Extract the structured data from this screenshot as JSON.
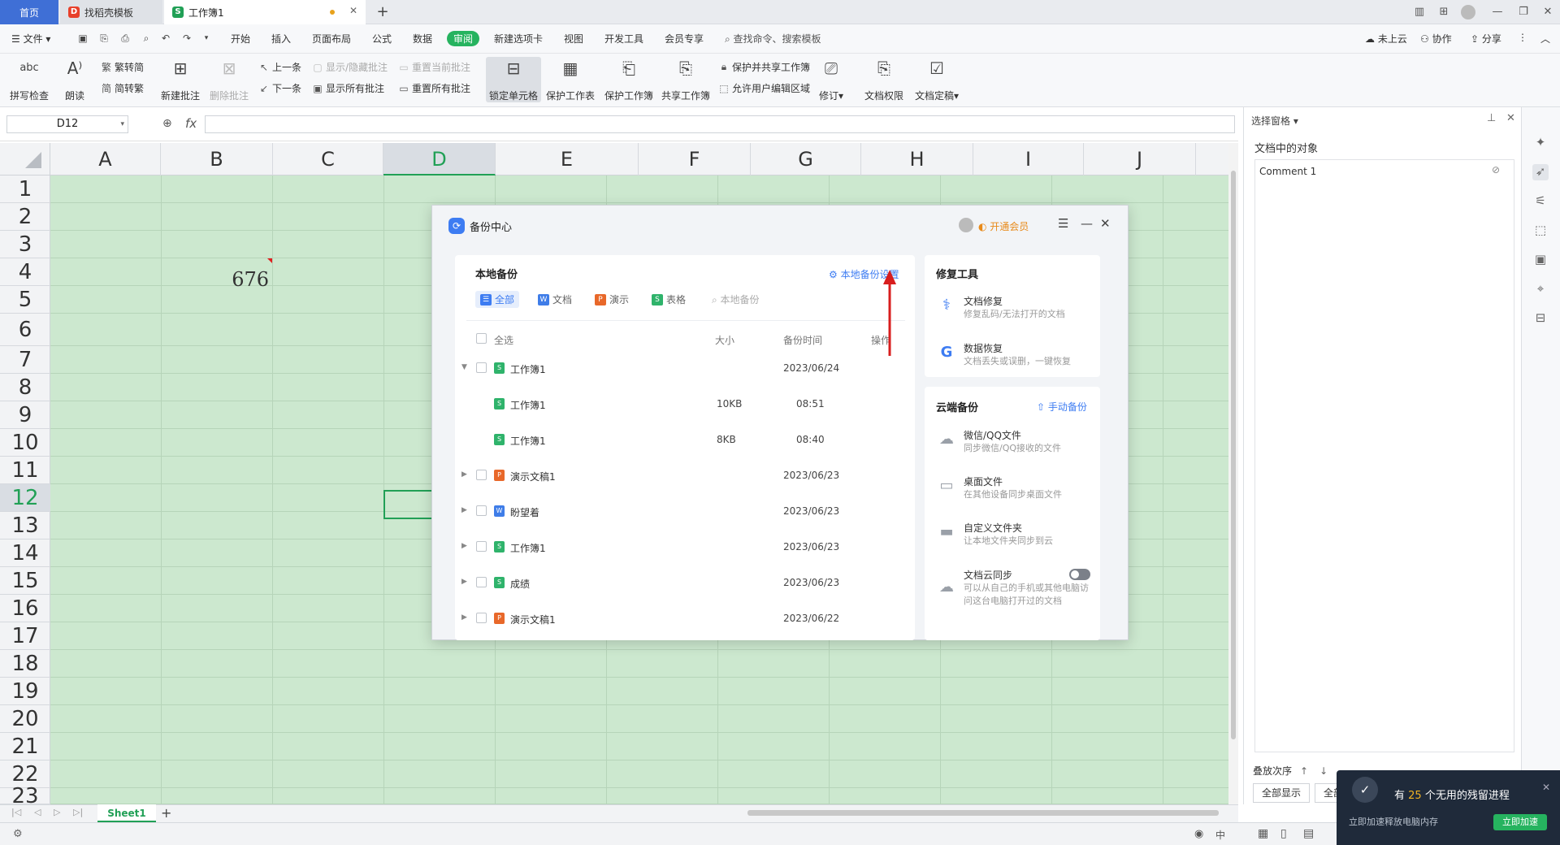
{
  "tabs": {
    "home": "首页",
    "template": "找稻壳模板",
    "workbook": "工作簿1",
    "new_tab": "+"
  },
  "menu": {
    "file": "文件",
    "items": [
      "开始",
      "插入",
      "页面布局",
      "公式",
      "数据",
      "审阅",
      "新建选项卡",
      "视图",
      "开发工具",
      "会员专享"
    ],
    "search": "查找命令、搜索模板",
    "cloud": "未上云",
    "collab": "协作",
    "share": "分享"
  },
  "ribbon": {
    "spell": "拼写检查",
    "read": "朗读",
    "trad": "繁转简",
    "simp": "简转繁",
    "new_comment": "新建批注",
    "del_comment": "删除批注",
    "prev": "上一条",
    "next": "下一条",
    "show_hide": "显示/隐藏批注",
    "show_all": "显示所有批注",
    "reset_cur": "重置当前批注",
    "reset_all": "重置所有批注",
    "lock_cell": "锁定单元格",
    "protect_sheet": "保护工作表",
    "protect_wb": "保护工作簿",
    "share_wb": "共享工作簿",
    "protect_share": "保护并共享工作簿",
    "allow_edit": "允许用户编辑区域",
    "revise": "修订",
    "doc_perm": "文档权限",
    "doc_final": "文档定稿"
  },
  "formula": {
    "namebox": "D12",
    "fx": "fx",
    "value": ""
  },
  "grid": {
    "columns": [
      "A",
      "B",
      "C",
      "D",
      "E",
      "F",
      "G",
      "H",
      "I",
      "J"
    ],
    "rows": [
      "1",
      "2",
      "3",
      "4",
      "5",
      "6",
      "7",
      "8",
      "9",
      "10",
      "11",
      "12",
      "13",
      "14",
      "15",
      "16",
      "17",
      "18",
      "19",
      "20",
      "21",
      "22",
      "23"
    ],
    "selected_col": "D",
    "selected_row": "12",
    "cell_b4": "676"
  },
  "sheets": {
    "active": "Sheet1",
    "add": "+"
  },
  "selection_pane": {
    "title": "选择窗格",
    "subtitle": "文档中的对象",
    "object": "Comment 1",
    "order": "叠放次序",
    "show_all": "全部显示",
    "hide_all": "全部隐藏"
  },
  "backup_dialog": {
    "title": "备份中心",
    "vip": "开通会员",
    "local": {
      "title": "本地备份",
      "settings": "本地备份设置",
      "filters": [
        "全部",
        "文档",
        "演示",
        "表格"
      ],
      "search": "本地备份",
      "headers": {
        "select_all": "全选",
        "size": "大小",
        "time": "备份时间",
        "op": "操作"
      },
      "rows": [
        {
          "name": "工作簿1",
          "size": "",
          "time": "2023/06/24",
          "type": "s",
          "level": 0
        },
        {
          "name": "工作簿1",
          "size": "10KB",
          "time": "08:51",
          "type": "s",
          "level": 1
        },
        {
          "name": "工作簿1",
          "size": "8KB",
          "time": "08:40",
          "type": "s",
          "level": 1
        },
        {
          "name": "演示文稿1",
          "size": "",
          "time": "2023/06/23",
          "type": "p",
          "level": 0
        },
        {
          "name": "盼望着",
          "size": "",
          "time": "2023/06/23",
          "type": "w",
          "level": 0
        },
        {
          "name": "工作簿1",
          "size": "",
          "time": "2023/06/23",
          "type": "s",
          "level": 0
        },
        {
          "name": "成绩",
          "size": "",
          "time": "2023/06/23",
          "type": "s",
          "level": 0
        },
        {
          "name": "演示文稿1",
          "size": "",
          "time": "2023/06/22",
          "type": "p",
          "level": 0
        }
      ]
    },
    "repair": {
      "title": "修复工具",
      "items": [
        {
          "t": "文档修复",
          "d": "修复乱码/无法打开的文档"
        },
        {
          "t": "数据恢复",
          "d": "文档丢失或误删，一键恢复"
        }
      ]
    },
    "cloud": {
      "title": "云端备份",
      "manual": "手动备份",
      "items": [
        {
          "t": "微信/QQ文件",
          "d": "同步微信/QQ接收的文件"
        },
        {
          "t": "桌面文件",
          "d": "在其他设备同步桌面文件"
        },
        {
          "t": "自定义文件夹",
          "d": "让本地文件夹同步到云"
        },
        {
          "t": "文档云同步",
          "d": "可以从自己的手机或其他电脑访问这台电脑打开过的文档"
        }
      ]
    }
  },
  "notification": {
    "pre": "有",
    "count": "25",
    "post": "个无用的残留进程",
    "sub": "立即加速释放电脑内存",
    "button": "立即加速"
  },
  "colors": {
    "accent": "#21a056",
    "grid_bg": "#cce8cf",
    "dialog_accent": "#3d7cf2",
    "arrow": "#d81e1e"
  }
}
